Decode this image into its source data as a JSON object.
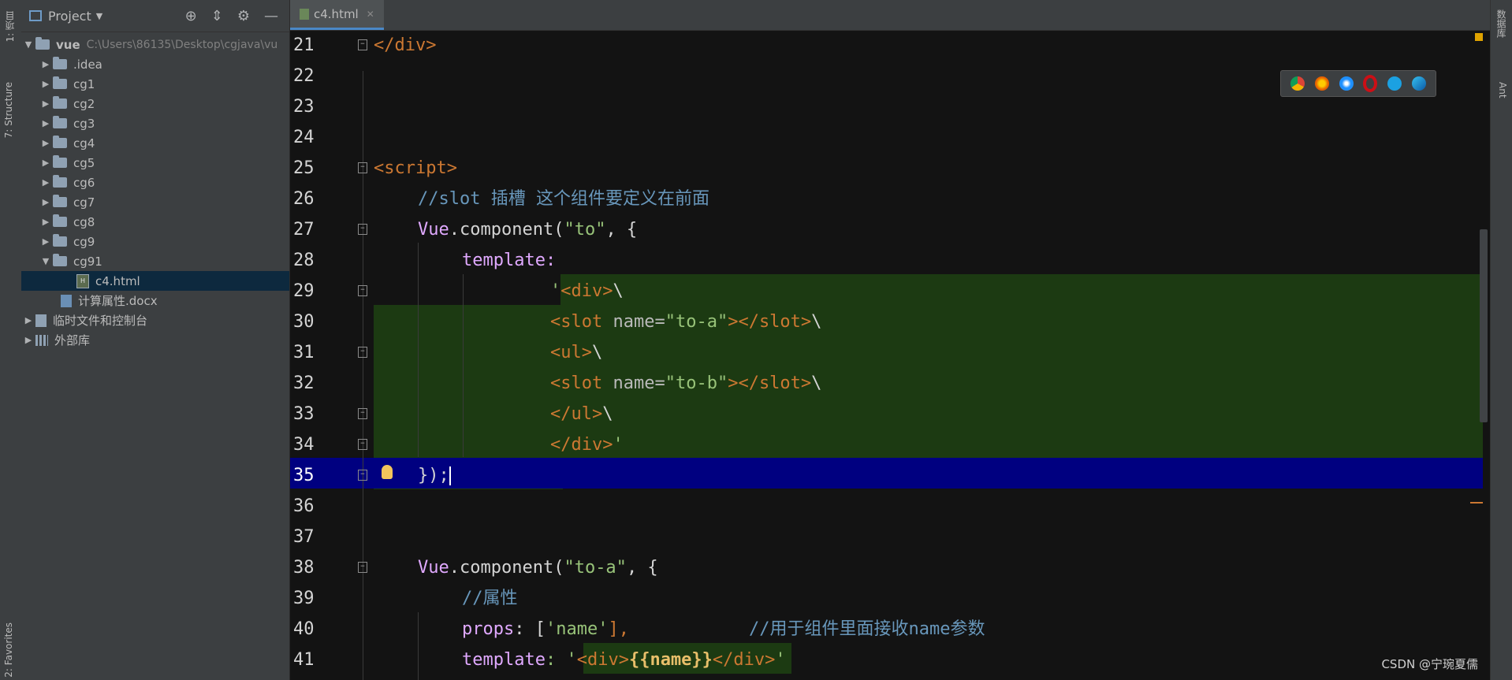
{
  "left_strip": {
    "tab1": "1: 项目",
    "tab2": "7: Structure",
    "tab3": "2: Favorites"
  },
  "right_strip": {
    "tab1": "数据库",
    "tab2": "Ant"
  },
  "project": {
    "title": "Project",
    "tools": [
      "target-icon",
      "collapse-icon",
      "gear-icon",
      "minimize-icon"
    ],
    "root_name": "vue",
    "root_path": "C:\\Users\\86135\\Desktop\\cgjava\\vu",
    "items": [
      ".idea",
      "cg1",
      "cg2",
      "cg3",
      "cg4",
      "cg5",
      "cg6",
      "cg7",
      "cg8",
      "cg9",
      "cg91"
    ],
    "selected_file": "c4.html",
    "doc_file": "计算属性.docx",
    "temp": "临时文件和控制台",
    "ext": "外部库"
  },
  "editor": {
    "tab_label": "c4.html",
    "lines": {
      "l21": "21",
      "l22": "22",
      "l23": "23",
      "l24": "24",
      "l25": "25",
      "l26": "26",
      "l27": "27",
      "l28": "28",
      "l29": "29",
      "l30": "30",
      "l31": "31",
      "l32": "32",
      "l33": "33",
      "l34": "34",
      "l35": "35",
      "l36": "36",
      "l37": "37",
      "l38": "38",
      "l39": "39",
      "l40": "40",
      "l41": "41"
    },
    "code": {
      "c21": "</div>",
      "c25": "<script>",
      "c26": "//slot 插槽 这个组件要定义在前面",
      "c27a": "Vue",
      "c27b": ".component(",
      "c27c": "\"to\"",
      "c27d": ", {",
      "c28": "template:",
      "c29a": "'",
      "c29b": "<div>",
      "c29c": "\\",
      "c30a": "<slot ",
      "c30b": "name=",
      "c30c": "\"to-a\"",
      "c30d": "></slot>",
      "c30e": "\\",
      "c31a": "<ul>",
      "c31b": "\\",
      "c32a": "<slot ",
      "c32b": "name=",
      "c32c": "\"to-b\"",
      "c32d": "></slot>",
      "c32e": "\\",
      "c33a": "</ul>",
      "c33b": "\\",
      "c34a": "</div>",
      "c34b": "'",
      "c35": "});",
      "c38a": "Vue",
      "c38b": ".component(",
      "c38c": "\"to-a\"",
      "c38d": ", {",
      "c39": "//属性",
      "c40a": "props",
      "c40b": ": [",
      "c40c": "'name'",
      "c40d": "],",
      "c40e": "//用于组件里面接收name参数",
      "c41a": "template",
      "c41b": ": '",
      "c41c": "<div>",
      "c41d": "{{name}}",
      "c41e": "</div>",
      "c41f": "'"
    }
  },
  "browser_icons": [
    "chrome-icon",
    "firefox-icon",
    "safari-icon",
    "opera-icon",
    "ie-icon",
    "edge-icon"
  ],
  "watermark": "CSDN @宁琬夏儒"
}
